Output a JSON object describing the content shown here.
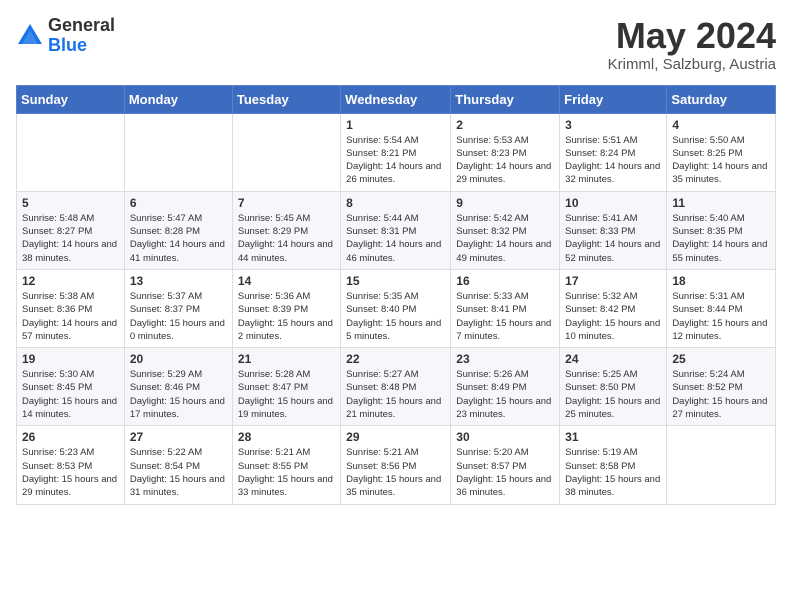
{
  "logo": {
    "general": "General",
    "blue": "Blue"
  },
  "header": {
    "month": "May 2024",
    "location": "Krimml, Salzburg, Austria"
  },
  "weekdays": [
    "Sunday",
    "Monday",
    "Tuesday",
    "Wednesday",
    "Thursday",
    "Friday",
    "Saturday"
  ],
  "weeks": [
    [
      {
        "day": "",
        "sunrise": "",
        "sunset": "",
        "daylight": ""
      },
      {
        "day": "",
        "sunrise": "",
        "sunset": "",
        "daylight": ""
      },
      {
        "day": "",
        "sunrise": "",
        "sunset": "",
        "daylight": ""
      },
      {
        "day": "1",
        "sunrise": "Sunrise: 5:54 AM",
        "sunset": "Sunset: 8:21 PM",
        "daylight": "Daylight: 14 hours and 26 minutes."
      },
      {
        "day": "2",
        "sunrise": "Sunrise: 5:53 AM",
        "sunset": "Sunset: 8:23 PM",
        "daylight": "Daylight: 14 hours and 29 minutes."
      },
      {
        "day": "3",
        "sunrise": "Sunrise: 5:51 AM",
        "sunset": "Sunset: 8:24 PM",
        "daylight": "Daylight: 14 hours and 32 minutes."
      },
      {
        "day": "4",
        "sunrise": "Sunrise: 5:50 AM",
        "sunset": "Sunset: 8:25 PM",
        "daylight": "Daylight: 14 hours and 35 minutes."
      }
    ],
    [
      {
        "day": "5",
        "sunrise": "Sunrise: 5:48 AM",
        "sunset": "Sunset: 8:27 PM",
        "daylight": "Daylight: 14 hours and 38 minutes."
      },
      {
        "day": "6",
        "sunrise": "Sunrise: 5:47 AM",
        "sunset": "Sunset: 8:28 PM",
        "daylight": "Daylight: 14 hours and 41 minutes."
      },
      {
        "day": "7",
        "sunrise": "Sunrise: 5:45 AM",
        "sunset": "Sunset: 8:29 PM",
        "daylight": "Daylight: 14 hours and 44 minutes."
      },
      {
        "day": "8",
        "sunrise": "Sunrise: 5:44 AM",
        "sunset": "Sunset: 8:31 PM",
        "daylight": "Daylight: 14 hours and 46 minutes."
      },
      {
        "day": "9",
        "sunrise": "Sunrise: 5:42 AM",
        "sunset": "Sunset: 8:32 PM",
        "daylight": "Daylight: 14 hours and 49 minutes."
      },
      {
        "day": "10",
        "sunrise": "Sunrise: 5:41 AM",
        "sunset": "Sunset: 8:33 PM",
        "daylight": "Daylight: 14 hours and 52 minutes."
      },
      {
        "day": "11",
        "sunrise": "Sunrise: 5:40 AM",
        "sunset": "Sunset: 8:35 PM",
        "daylight": "Daylight: 14 hours and 55 minutes."
      }
    ],
    [
      {
        "day": "12",
        "sunrise": "Sunrise: 5:38 AM",
        "sunset": "Sunset: 8:36 PM",
        "daylight": "Daylight: 14 hours and 57 minutes."
      },
      {
        "day": "13",
        "sunrise": "Sunrise: 5:37 AM",
        "sunset": "Sunset: 8:37 PM",
        "daylight": "Daylight: 15 hours and 0 minutes."
      },
      {
        "day": "14",
        "sunrise": "Sunrise: 5:36 AM",
        "sunset": "Sunset: 8:39 PM",
        "daylight": "Daylight: 15 hours and 2 minutes."
      },
      {
        "day": "15",
        "sunrise": "Sunrise: 5:35 AM",
        "sunset": "Sunset: 8:40 PM",
        "daylight": "Daylight: 15 hours and 5 minutes."
      },
      {
        "day": "16",
        "sunrise": "Sunrise: 5:33 AM",
        "sunset": "Sunset: 8:41 PM",
        "daylight": "Daylight: 15 hours and 7 minutes."
      },
      {
        "day": "17",
        "sunrise": "Sunrise: 5:32 AM",
        "sunset": "Sunset: 8:42 PM",
        "daylight": "Daylight: 15 hours and 10 minutes."
      },
      {
        "day": "18",
        "sunrise": "Sunrise: 5:31 AM",
        "sunset": "Sunset: 8:44 PM",
        "daylight": "Daylight: 15 hours and 12 minutes."
      }
    ],
    [
      {
        "day": "19",
        "sunrise": "Sunrise: 5:30 AM",
        "sunset": "Sunset: 8:45 PM",
        "daylight": "Daylight: 15 hours and 14 minutes."
      },
      {
        "day": "20",
        "sunrise": "Sunrise: 5:29 AM",
        "sunset": "Sunset: 8:46 PM",
        "daylight": "Daylight: 15 hours and 17 minutes."
      },
      {
        "day": "21",
        "sunrise": "Sunrise: 5:28 AM",
        "sunset": "Sunset: 8:47 PM",
        "daylight": "Daylight: 15 hours and 19 minutes."
      },
      {
        "day": "22",
        "sunrise": "Sunrise: 5:27 AM",
        "sunset": "Sunset: 8:48 PM",
        "daylight": "Daylight: 15 hours and 21 minutes."
      },
      {
        "day": "23",
        "sunrise": "Sunrise: 5:26 AM",
        "sunset": "Sunset: 8:49 PM",
        "daylight": "Daylight: 15 hours and 23 minutes."
      },
      {
        "day": "24",
        "sunrise": "Sunrise: 5:25 AM",
        "sunset": "Sunset: 8:50 PM",
        "daylight": "Daylight: 15 hours and 25 minutes."
      },
      {
        "day": "25",
        "sunrise": "Sunrise: 5:24 AM",
        "sunset": "Sunset: 8:52 PM",
        "daylight": "Daylight: 15 hours and 27 minutes."
      }
    ],
    [
      {
        "day": "26",
        "sunrise": "Sunrise: 5:23 AM",
        "sunset": "Sunset: 8:53 PM",
        "daylight": "Daylight: 15 hours and 29 minutes."
      },
      {
        "day": "27",
        "sunrise": "Sunrise: 5:22 AM",
        "sunset": "Sunset: 8:54 PM",
        "daylight": "Daylight: 15 hours and 31 minutes."
      },
      {
        "day": "28",
        "sunrise": "Sunrise: 5:21 AM",
        "sunset": "Sunset: 8:55 PM",
        "daylight": "Daylight: 15 hours and 33 minutes."
      },
      {
        "day": "29",
        "sunrise": "Sunrise: 5:21 AM",
        "sunset": "Sunset: 8:56 PM",
        "daylight": "Daylight: 15 hours and 35 minutes."
      },
      {
        "day": "30",
        "sunrise": "Sunrise: 5:20 AM",
        "sunset": "Sunset: 8:57 PM",
        "daylight": "Daylight: 15 hours and 36 minutes."
      },
      {
        "day": "31",
        "sunrise": "Sunrise: 5:19 AM",
        "sunset": "Sunset: 8:58 PM",
        "daylight": "Daylight: 15 hours and 38 minutes."
      },
      {
        "day": "",
        "sunrise": "",
        "sunset": "",
        "daylight": ""
      }
    ]
  ]
}
